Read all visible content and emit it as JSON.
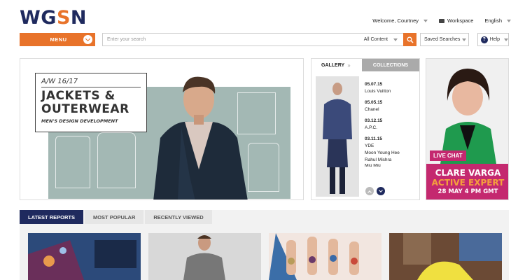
{
  "brand": {
    "logo_a": "WG",
    "logo_s": "S",
    "logo_b": "N"
  },
  "header": {
    "welcome": "Welcome, Courtney",
    "workspace": "Workspace",
    "language": "English"
  },
  "toolbar": {
    "menu_label": "MENU",
    "search_placeholder": "Enter your search",
    "search_scope": "All Content",
    "saved_searches": "Saved Searches",
    "help": "Help"
  },
  "hero": {
    "season": "A/W 16/17",
    "title_line1": "JACKETS &",
    "title_line2": "OUTERWEAR",
    "subtitle": "MEN'S DESIGN DEVELOPMENT"
  },
  "gallery": {
    "tab_gallery": "GALLERY",
    "tab_collections": "COLLECTIONS",
    "entries": [
      {
        "date": "05.07.15",
        "names": [
          "Louis Vuitton"
        ]
      },
      {
        "date": "05.05.15",
        "names": [
          "Chanel"
        ]
      },
      {
        "date": "03.12.15",
        "names": [
          "A.P.C."
        ]
      },
      {
        "date": "03.11.15",
        "names": [
          "YDE",
          "Moon Young Hee",
          "Rahul Mishra",
          "Miu Miu"
        ]
      }
    ]
  },
  "live_chat": {
    "label": "LIVE CHAT",
    "name": "CLARE VARGA",
    "role": "ACTIVE EXPERT",
    "when": "28 MAY 4 PM GMT"
  },
  "reports": {
    "tabs": [
      "LATEST REPORTS",
      "MOST POPULAR",
      "RECENTLY VIEWED"
    ]
  },
  "colors": {
    "brand_navy": "#1f2a5e",
    "accent_orange": "#e8732a",
    "accent_magenta": "#c4296f"
  }
}
